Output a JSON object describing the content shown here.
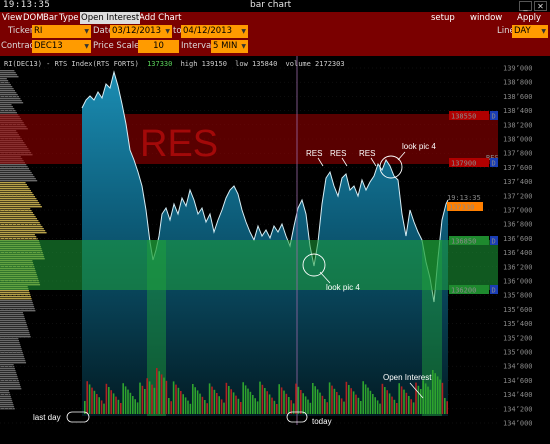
{
  "window": {
    "clock": "19:13:35",
    "title": "bar chart"
  },
  "menu": {
    "left": [
      "View",
      "DOM",
      "Bar",
      "Type",
      "Open Interest",
      "Add Chart"
    ],
    "right": [
      "setup",
      "window",
      "Apply"
    ]
  },
  "toolbar": {
    "ticker_label": "Ticker",
    "ticker_value": "RI",
    "date_label": "Date",
    "date_from": "03/12/2013",
    "to_label": "to",
    "date_to": "04/12/2013",
    "line_label": "Line",
    "line_value": "DAY",
    "contract_label": "Contract",
    "contract_value": "DEC13",
    "price_scale_label": "Price Scale",
    "price_scale_value": "10",
    "interval_label": "Interval",
    "interval_value": "5 MIN"
  },
  "chart": {
    "header": "RI(DEC13) - RTS Index(RTS FORTS)",
    "header_last": "137330",
    "header_high": "high 139150",
    "header_low": "low 135840",
    "header_volume": "volume 2172303",
    "price_labels": [
      "139000",
      "138800",
      "138600",
      "138400",
      "138200",
      "138000",
      "137800",
      "137600",
      "137400",
      "137200",
      "137000",
      "136800",
      "136600",
      "136400",
      "136200",
      "136000",
      "135800",
      "135600",
      "135400",
      "135200",
      "135000",
      "134800",
      "134600",
      "134400",
      "134200",
      "134000"
    ],
    "badges": {
      "res_top": "138550",
      "res_bottom": "137900",
      "sup_top": "136850",
      "sup_bottom": "136200",
      "last": "137330",
      "time": "19:13:35",
      "badge_letter": "D",
      "res_tag": "RES"
    },
    "annotations": {
      "res_zone_label": "RES",
      "res1": "RES",
      "res2": "RES",
      "res3": "RES",
      "look_pic_top": "look pic 4",
      "look_pic_bottom": "look pic 4",
      "open_interest": "Open Interest",
      "last_day": "last day",
      "today": "today"
    },
    "colors": {
      "res_zone": "#b00000",
      "sup_zone": "#1e9e3a",
      "price_line": "#c8e6f0",
      "last_price": "#ff7f00",
      "volume_up": "#2ea32e",
      "volume_down": "#b22222"
    }
  }
}
